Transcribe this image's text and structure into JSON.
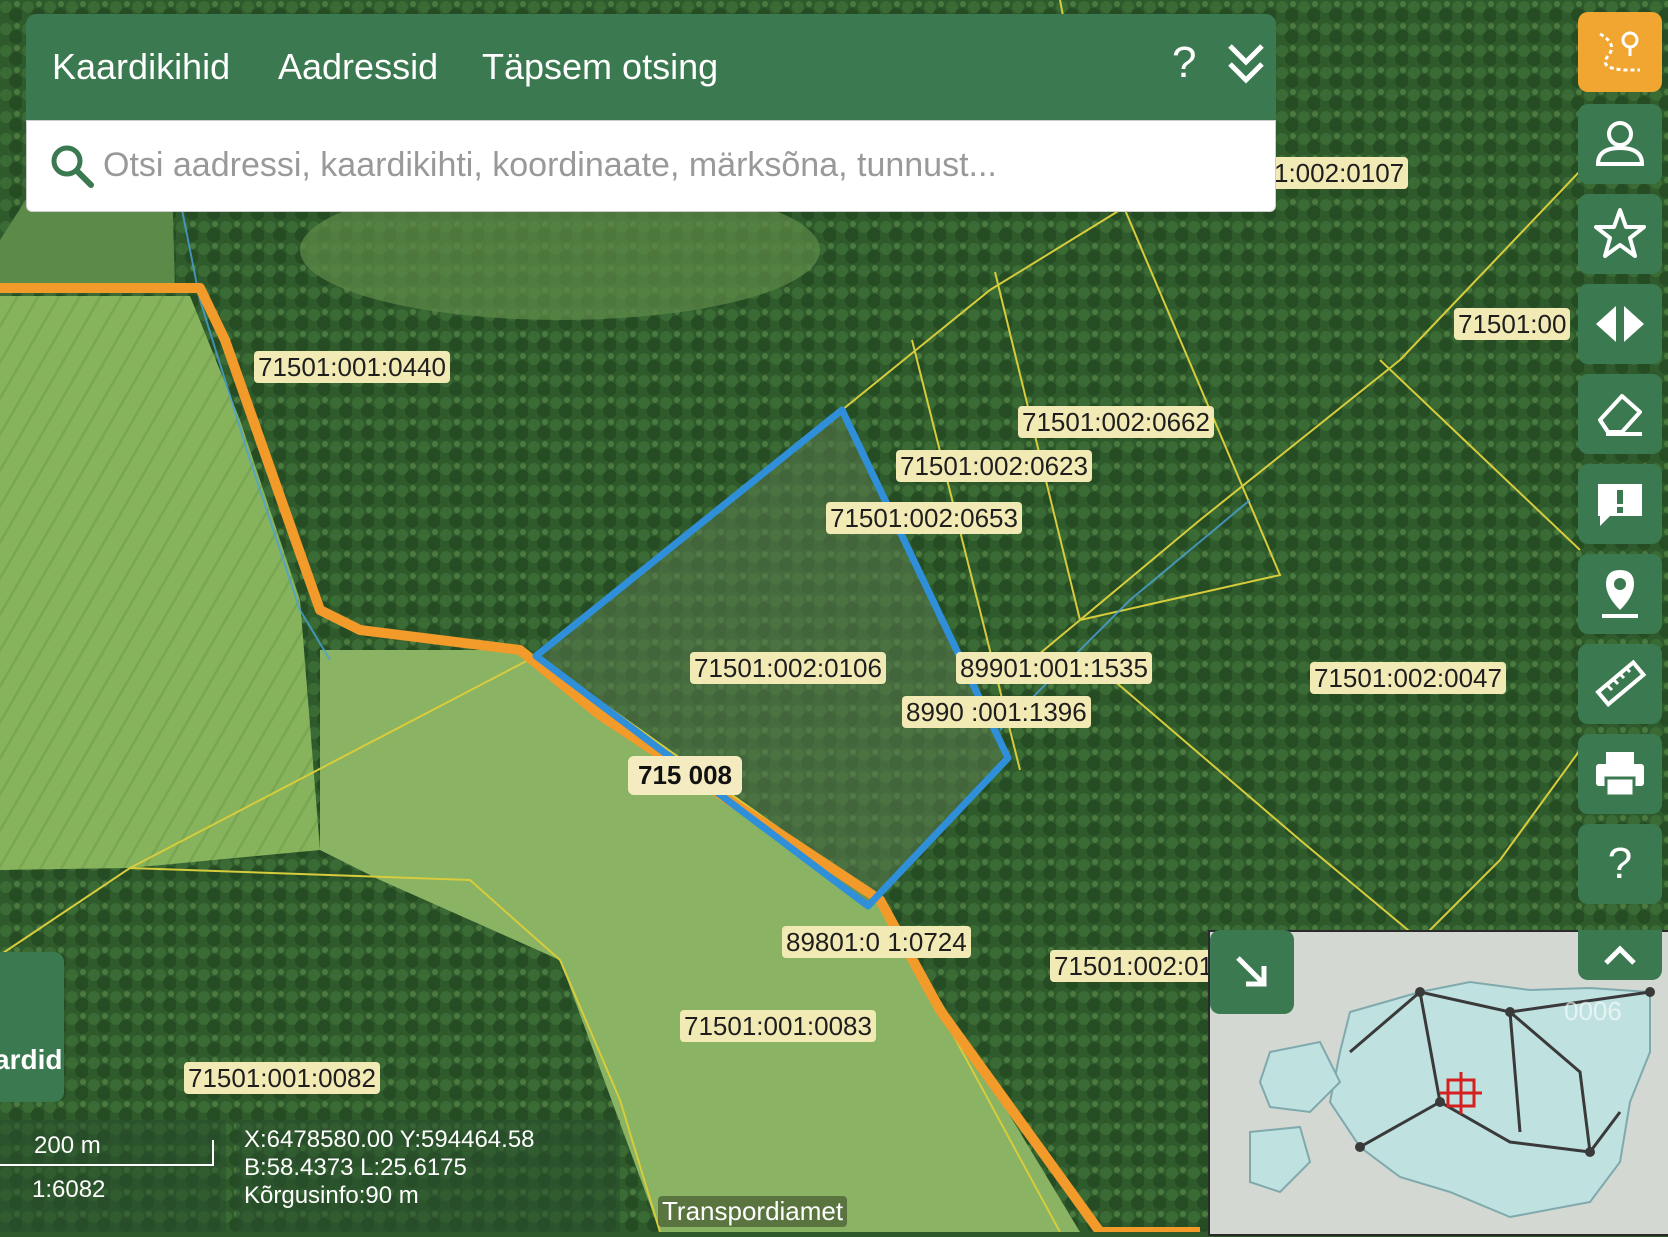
{
  "header": {
    "tabs": [
      {
        "label": "Kaardikihid"
      },
      {
        "label": "Aadressid"
      },
      {
        "label": "Täpsem otsing"
      }
    ],
    "help_label": "?",
    "search": {
      "value": "",
      "placeholder": "Otsi aadressi, kaardikihti, koordinaate, märksõna, tunnust..."
    }
  },
  "toolbar": {
    "items": [
      {
        "icon": "route-pin-icon",
        "active": true
      },
      {
        "icon": "user-icon",
        "active": false
      },
      {
        "icon": "star-icon",
        "active": false
      },
      {
        "icon": "compare-arrows-icon",
        "active": false
      },
      {
        "icon": "eraser-icon",
        "active": false
      },
      {
        "icon": "feedback-icon",
        "active": false
      },
      {
        "icon": "location-pin-icon",
        "active": false
      },
      {
        "icon": "ruler-icon",
        "active": false
      },
      {
        "icon": "printer-icon",
        "active": false
      },
      {
        "icon": "help-icon",
        "active": false
      }
    ],
    "help_label": "?"
  },
  "map": {
    "parcel_labels": [
      "1:002:0107",
      "71501:001:0440",
      "71501:00",
      "71501:002:0662",
      "71501:002:0623",
      "71501:002:0653",
      "71501:002:0106",
      "89901:001:1535",
      "8990 :001:1396",
      "71501:002:0047",
      "89801:0 1:0724",
      "71501:002:01",
      "71501:001:0083",
      "71501:001:0082"
    ],
    "road_label": "715 008",
    "selected_parcel": "71501:002:0106",
    "colors": {
      "forest": "#2f5a2c",
      "field": "#7fae5a",
      "road": "#f29a2a",
      "parcel_line": "#e0d24a",
      "selection": "#2f8fd8"
    }
  },
  "left_panel": {
    "tab_label": "ardid"
  },
  "status": {
    "scale_distance": "200 m",
    "scale_ratio": "1:6082",
    "coords_xy": "X:6478580.00 Y:594464.58",
    "coords_bl": "B:58.4373 L:25.6175",
    "elevation": "Kõrgusinfo:90 m",
    "attribution": "Transpordiamet"
  },
  "overview": {
    "ghost_label": "0006",
    "marker_color": "#d42020"
  }
}
